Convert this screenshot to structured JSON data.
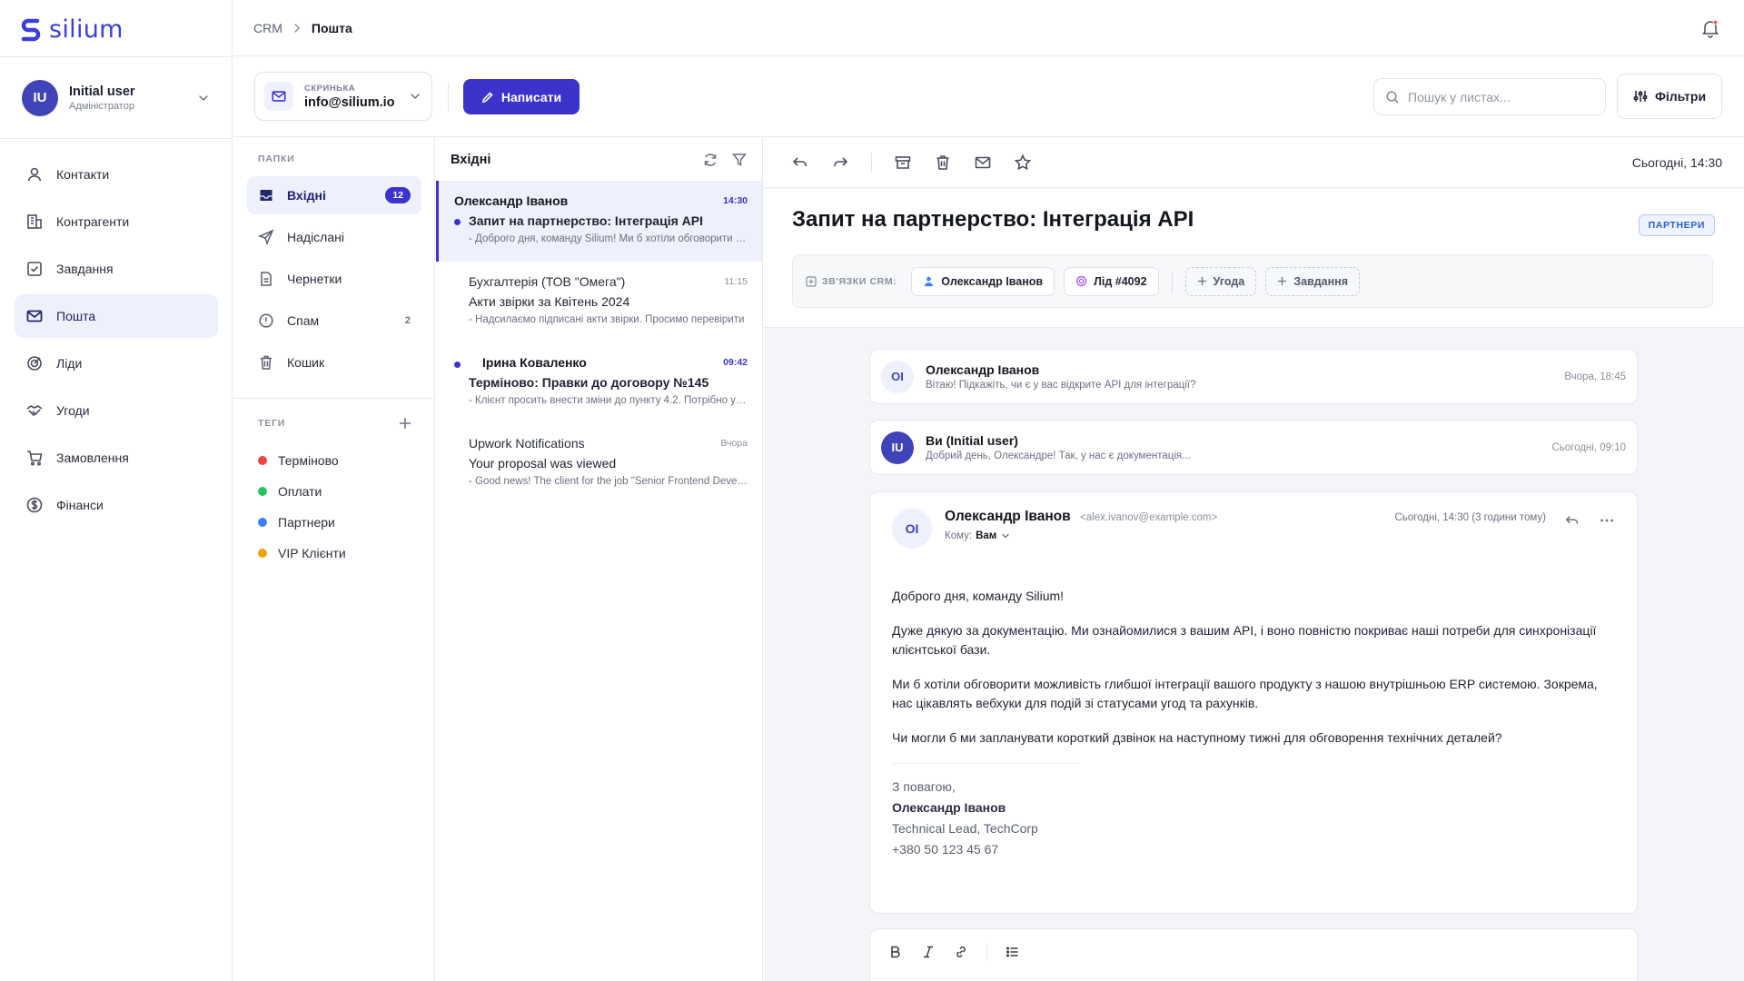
{
  "app": {
    "brand": "silium"
  },
  "user": {
    "initials": "IU",
    "name": "Initial user",
    "role": "Адміністратор"
  },
  "nav": [
    {
      "label": "Контакти",
      "icon": "user-icon"
    },
    {
      "label": "Контрагенти",
      "icon": "building-icon"
    },
    {
      "label": "Завдання",
      "icon": "task-icon"
    },
    {
      "label": "Пошта",
      "icon": "mail-icon",
      "active": true
    },
    {
      "label": "Ліди",
      "icon": "target-icon"
    },
    {
      "label": "Угоди",
      "icon": "handshake-icon"
    },
    {
      "label": "Замовлення",
      "icon": "cart-icon"
    },
    {
      "label": "Фінанси",
      "icon": "dollar-icon"
    }
  ],
  "breadcrumb": {
    "root": "CRM",
    "current": "Пошта"
  },
  "mailbox": {
    "label": "СКРИНЬКА",
    "value": "info@silium.io"
  },
  "compose": {
    "label": "Написати"
  },
  "search": {
    "placeholder": "Пошук у листах..."
  },
  "filters": {
    "label": "Фільтри"
  },
  "folders": {
    "title": "ПАПКИ",
    "items": [
      {
        "label": "Вхідні",
        "count": "12",
        "active": true
      },
      {
        "label": "Надіслані",
        "count": ""
      },
      {
        "label": "Чернетки",
        "count": ""
      },
      {
        "label": "Спам",
        "count": "2"
      },
      {
        "label": "Кошик",
        "count": ""
      }
    ]
  },
  "tags": {
    "title": "ТЕГИ",
    "items": [
      {
        "label": "Терміново",
        "color": "#ef4444"
      },
      {
        "label": "Оплати",
        "color": "#22c55e"
      },
      {
        "label": "Партнери",
        "color": "#3b82f6"
      },
      {
        "label": "VIP Клієнти",
        "color": "#f59e0b"
      }
    ]
  },
  "list": {
    "title": "Вхідні",
    "messages": [
      {
        "from": "Олександр Іванов",
        "time": "14:30",
        "subject": "Запит на партнерство: Інтеграція API",
        "snippet": "- Доброго дня, команду Silium! Ми б хотіли обговорити можливість",
        "unread": true,
        "active": true
      },
      {
        "from": "Бухгалтерія (ТОВ \"Омега\")",
        "time": "11:15",
        "subject": "Акти звірки за Квітень 2024",
        "snippet": "- Надсилаємо підписані акти звірки. Просимо перевірити",
        "unread": false
      },
      {
        "from": "Ірина Коваленко",
        "time": "09:42",
        "subject": "Терміново: Правки до договору №145",
        "snippet": "- Клієнт просить внести зміни до пункту 4.2. Потрібно узгодити",
        "unread": true
      },
      {
        "from": "Upwork Notifications",
        "time": "Вчора",
        "subject": "Your proposal was viewed",
        "snippet": "- Good news! The client for the job \"Senior Frontend Developer\"",
        "unread": false
      }
    ]
  },
  "reader": {
    "date": "Сьогодні, 14:30",
    "subject": "Запит на партнерство: Інтеграція API",
    "badge": "ПАРТНЕРИ",
    "crm": {
      "label": "ЗВ'ЯЗКИ CRM:",
      "contact": "Олександр Іванов",
      "lead": "Лід #4092",
      "add_deal": "Угода",
      "add_task": "Завдання"
    },
    "thread": [
      {
        "initials": "OI",
        "name": "Олександр Іванов",
        "preview": "Вітаю! Підкажіть, чи є у вас відкрите API для інтеграції?",
        "date": "Вчора, 18:45"
      },
      {
        "initials": "IU",
        "name": "Ви (Initial user)",
        "preview": "Добрий день, Олександре! Так, у нас є документація...",
        "date": "Сьогодні, 09:10"
      }
    ],
    "message": {
      "initials": "OI",
      "name": "Олександр Іванов",
      "email": "<alex.ivanov@example.com>",
      "to_label": "Кому:",
      "to_value": "Вам",
      "date": "Сьогодні, 14:30 (3 години тому)",
      "body": [
        "Доброго дня, команду Silium!",
        "Дуже дякую за документацію. Ми ознайомилися з вашим API, і воно повністю покриває наші потреби для синхронізації клієнтської бази.",
        "Ми б хотіли обговорити можливість глибшої інтеграції вашого продукту з нашою внутрішньою ERP системою. Зокрема, нас цікавлять вебхуки для подій зі статусами угод та рахунків.",
        "Чи могли б ми запланувати короткий дзвінок на наступному тижні для обговорення технічних деталей?"
      ],
      "signature": {
        "greeting": "З повагою,",
        "name": "Олександр Іванов",
        "position": "Technical Lead, TechCorp",
        "phone": "+380 50 123 45 67"
      }
    }
  }
}
